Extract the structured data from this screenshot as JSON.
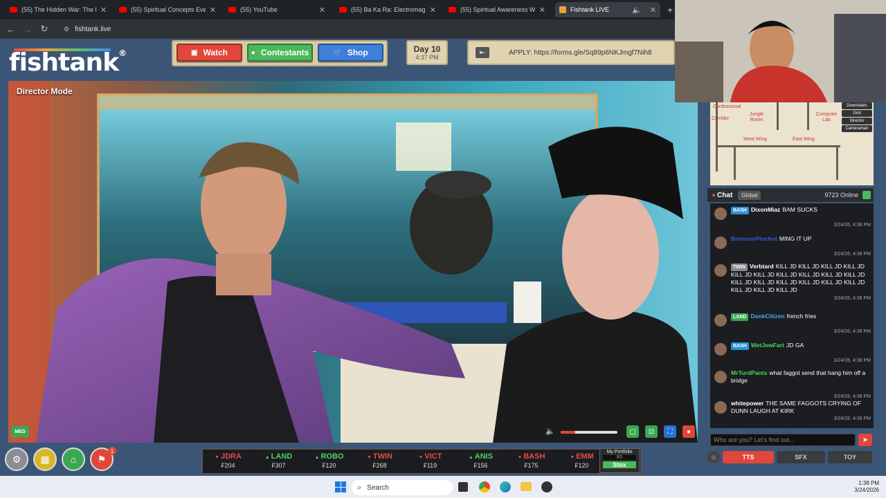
{
  "browser": {
    "tabs": [
      {
        "title": "(55) The Hidden War: The Loos"
      },
      {
        "title": "(55) Spiritual Concepts Everyon"
      },
      {
        "title": "(55) YouTube"
      },
      {
        "title": "(55) Ba Ka Ra: Electromagnetic"
      },
      {
        "title": "(55) Spiritual Awareness Will Re"
      },
      {
        "title": "Fishtank LIVE"
      }
    ],
    "url": "fishtank.live"
  },
  "site": {
    "logo": "fishtank",
    "nav": {
      "watch": "Watch",
      "contestants": "Contestants",
      "shop": "Shop"
    },
    "day": "Day 10",
    "time": "4:37 PM",
    "apply": "APPLY: https://forms.gle/Sq89p6NKJmgf7Nih8"
  },
  "video": {
    "mode_label": "Director Mode",
    "quality_badge": "MED",
    "volume_level": 0.25
  },
  "map": {
    "rooms": [
      "Confessional",
      "Jungle Room",
      "Computer Lab",
      "Corridor",
      "West Wing",
      "East Wing"
    ],
    "side_buttons": [
      "Downstairs",
      "Grid",
      "Director",
      "Cameraman"
    ]
  },
  "chat": {
    "title": "Chat",
    "global": "Global",
    "online": "9723 Online",
    "messages": [
      {
        "badge": "BASH",
        "badge_color": "#2a8fd8",
        "user": "DixonMiaz",
        "user_color": "#ffffff",
        "text": "BAM SUCKS",
        "time": "3/24/26, 4:38 PM"
      },
      {
        "badge": "",
        "badge_color": "",
        "user": "BronsonPinchot",
        "user_color": "#3a5ad8",
        "text": "MING IT UP",
        "time": "3/24/26, 4:38 PM"
      },
      {
        "badge": "TWIN",
        "badge_color": "#888888",
        "user": "Verbtard",
        "user_color": "#ffffff",
        "text": "KILL JD KILL JD KILL JD KILL JD KILL JD KILL JD KILL JD KILL JD KILL JD KILL JD KILL JD KILL JD KILL JD KILL JD KILL JD KILL JD KILL JD KILL JD KILL JD",
        "time": "3/24/26, 4:38 PM"
      },
      {
        "badge": "LAND",
        "badge_color": "#3ca752",
        "user": "DankCitizen",
        "user_color": "#4aa8e8",
        "text": "french fries",
        "time": "3/24/26, 4:38 PM"
      },
      {
        "badge": "BASH",
        "badge_color": "#2a8fd8",
        "user": "WetJewFart",
        "user_color": "#4cd264",
        "text": "JD GA",
        "time": "3/24/26, 4:38 PM"
      },
      {
        "badge": "",
        "badge_color": "",
        "user": "MrTurdPants",
        "user_color": "#4cd264",
        "text": "what faggot send that hang him off a bridge",
        "time": "3/24/26, 4:38 PM"
      },
      {
        "badge": "",
        "badge_color": "",
        "user": "whitepower",
        "user_color": "#ffffff",
        "text": "THE SAME FAGGOTS CRYING OF DUNN LAUGH AT KIRK",
        "time": "3/24/26, 4:38 PM"
      }
    ],
    "input_placeholder": "Who are you? Let's find out...",
    "footer": {
      "tts": "TTS",
      "sfx": "SFX",
      "toy": "TOY"
    }
  },
  "ticker": [
    {
      "name": "JDRA",
      "dir": "down",
      "price": "204"
    },
    {
      "name": "LAND",
      "dir": "up",
      "price": "307"
    },
    {
      "name": "ROBO",
      "dir": "up",
      "price": "120"
    },
    {
      "name": "TWIN",
      "dir": "down",
      "price": "268"
    },
    {
      "name": "VICT",
      "dir": "down",
      "price": "119"
    },
    {
      "name": "ANIS",
      "dir": "up",
      "price": "156"
    },
    {
      "name": "BASH",
      "dir": "down",
      "price": "175"
    },
    {
      "name": "EMM",
      "dir": "down",
      "price": "120"
    }
  ],
  "portfolio": {
    "title": "My Portfolio",
    "value": "₣0",
    "button": "Stox"
  },
  "notification_count": "1",
  "taskbar": {
    "search": "Search",
    "time": "1:38 PM",
    "date": "3/24/2026"
  }
}
